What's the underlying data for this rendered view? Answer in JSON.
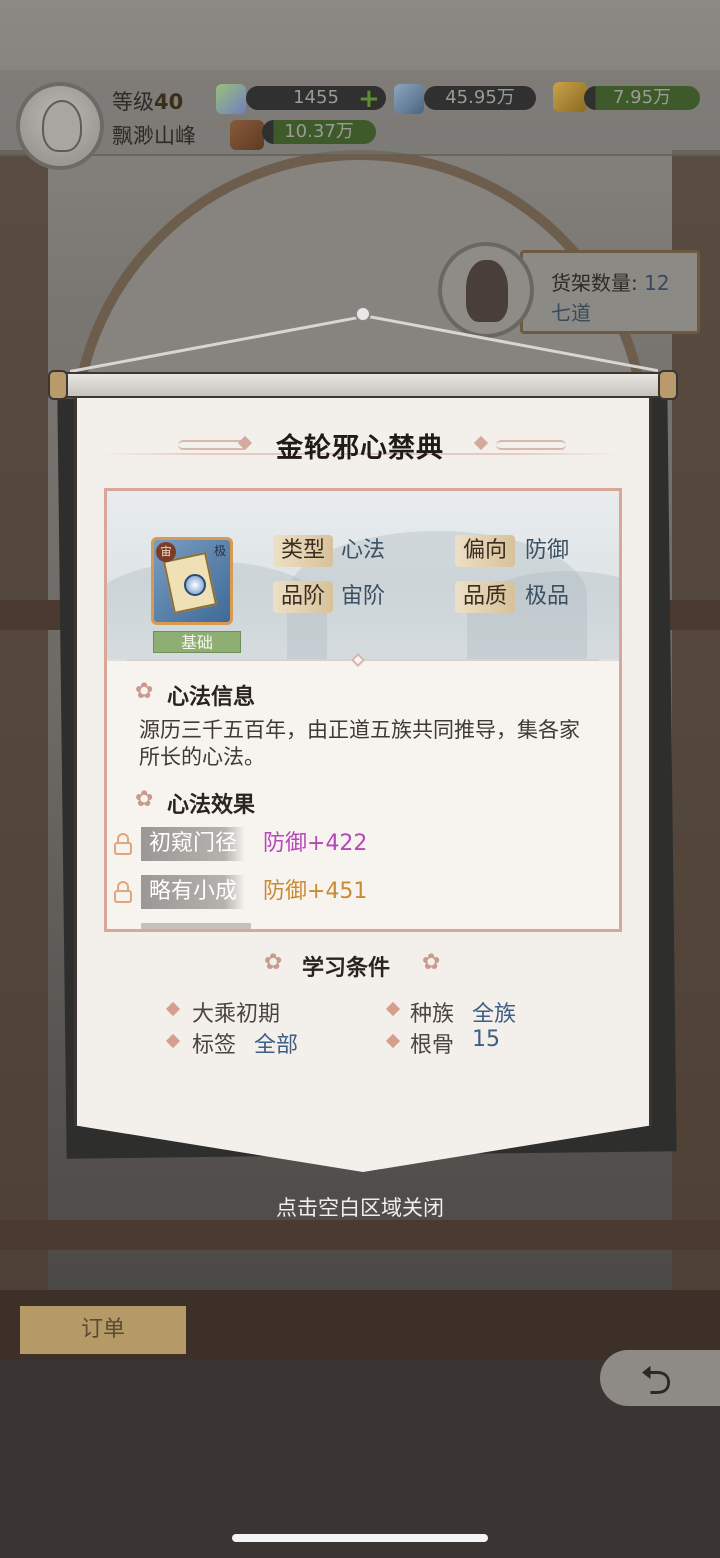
{
  "top_bar": {
    "level_label": "等级",
    "level_value": "40",
    "region": "飘渺山峰",
    "resources": [
      {
        "icon": "crystal-gem-icon",
        "value": "1455"
      },
      {
        "icon": "blue-stone-icon",
        "value": "45.95万"
      },
      {
        "icon": "gold-ingot-icon",
        "value": "7.95万"
      },
      {
        "icon": "wood-log-icon",
        "value": "10.37万"
      }
    ],
    "plus_glyph": "+"
  },
  "shelf": {
    "count_label": "货架数量:",
    "count_value": "12",
    "owner": "七道"
  },
  "modal": {
    "title": "金轮邪心禁典",
    "item_badge": "基础",
    "attributes": [
      {
        "label": "类型",
        "value": "心法"
      },
      {
        "label": "偏向",
        "value": "防御"
      },
      {
        "label": "品阶",
        "value": "宙阶"
      },
      {
        "label": "品质",
        "value": "极品"
      }
    ],
    "info_title": "心法信息",
    "description": "源历三千五百年，由正道五族共同推导，集各家所长的心法。",
    "effects_title": "心法效果",
    "effects": [
      {
        "stage": "初窥门径",
        "bonus": "防御+422",
        "color": "#b548b8"
      },
      {
        "stage": "略有小成",
        "bonus": "防御+451",
        "color": "#c98a33"
      }
    ],
    "conditions_title": "学习条件",
    "conditions": [
      {
        "label": "大乘初期",
        "value": ""
      },
      {
        "label": "种族",
        "value": "全族"
      },
      {
        "label": "标签",
        "value": "全部"
      },
      {
        "label": "根骨",
        "value": "15"
      }
    ]
  },
  "close_hint": "点击空白区域关闭",
  "orders_tab": "订单",
  "colors": {
    "accent_border": "#d9a797",
    "value_blue": "#3e5e83"
  }
}
